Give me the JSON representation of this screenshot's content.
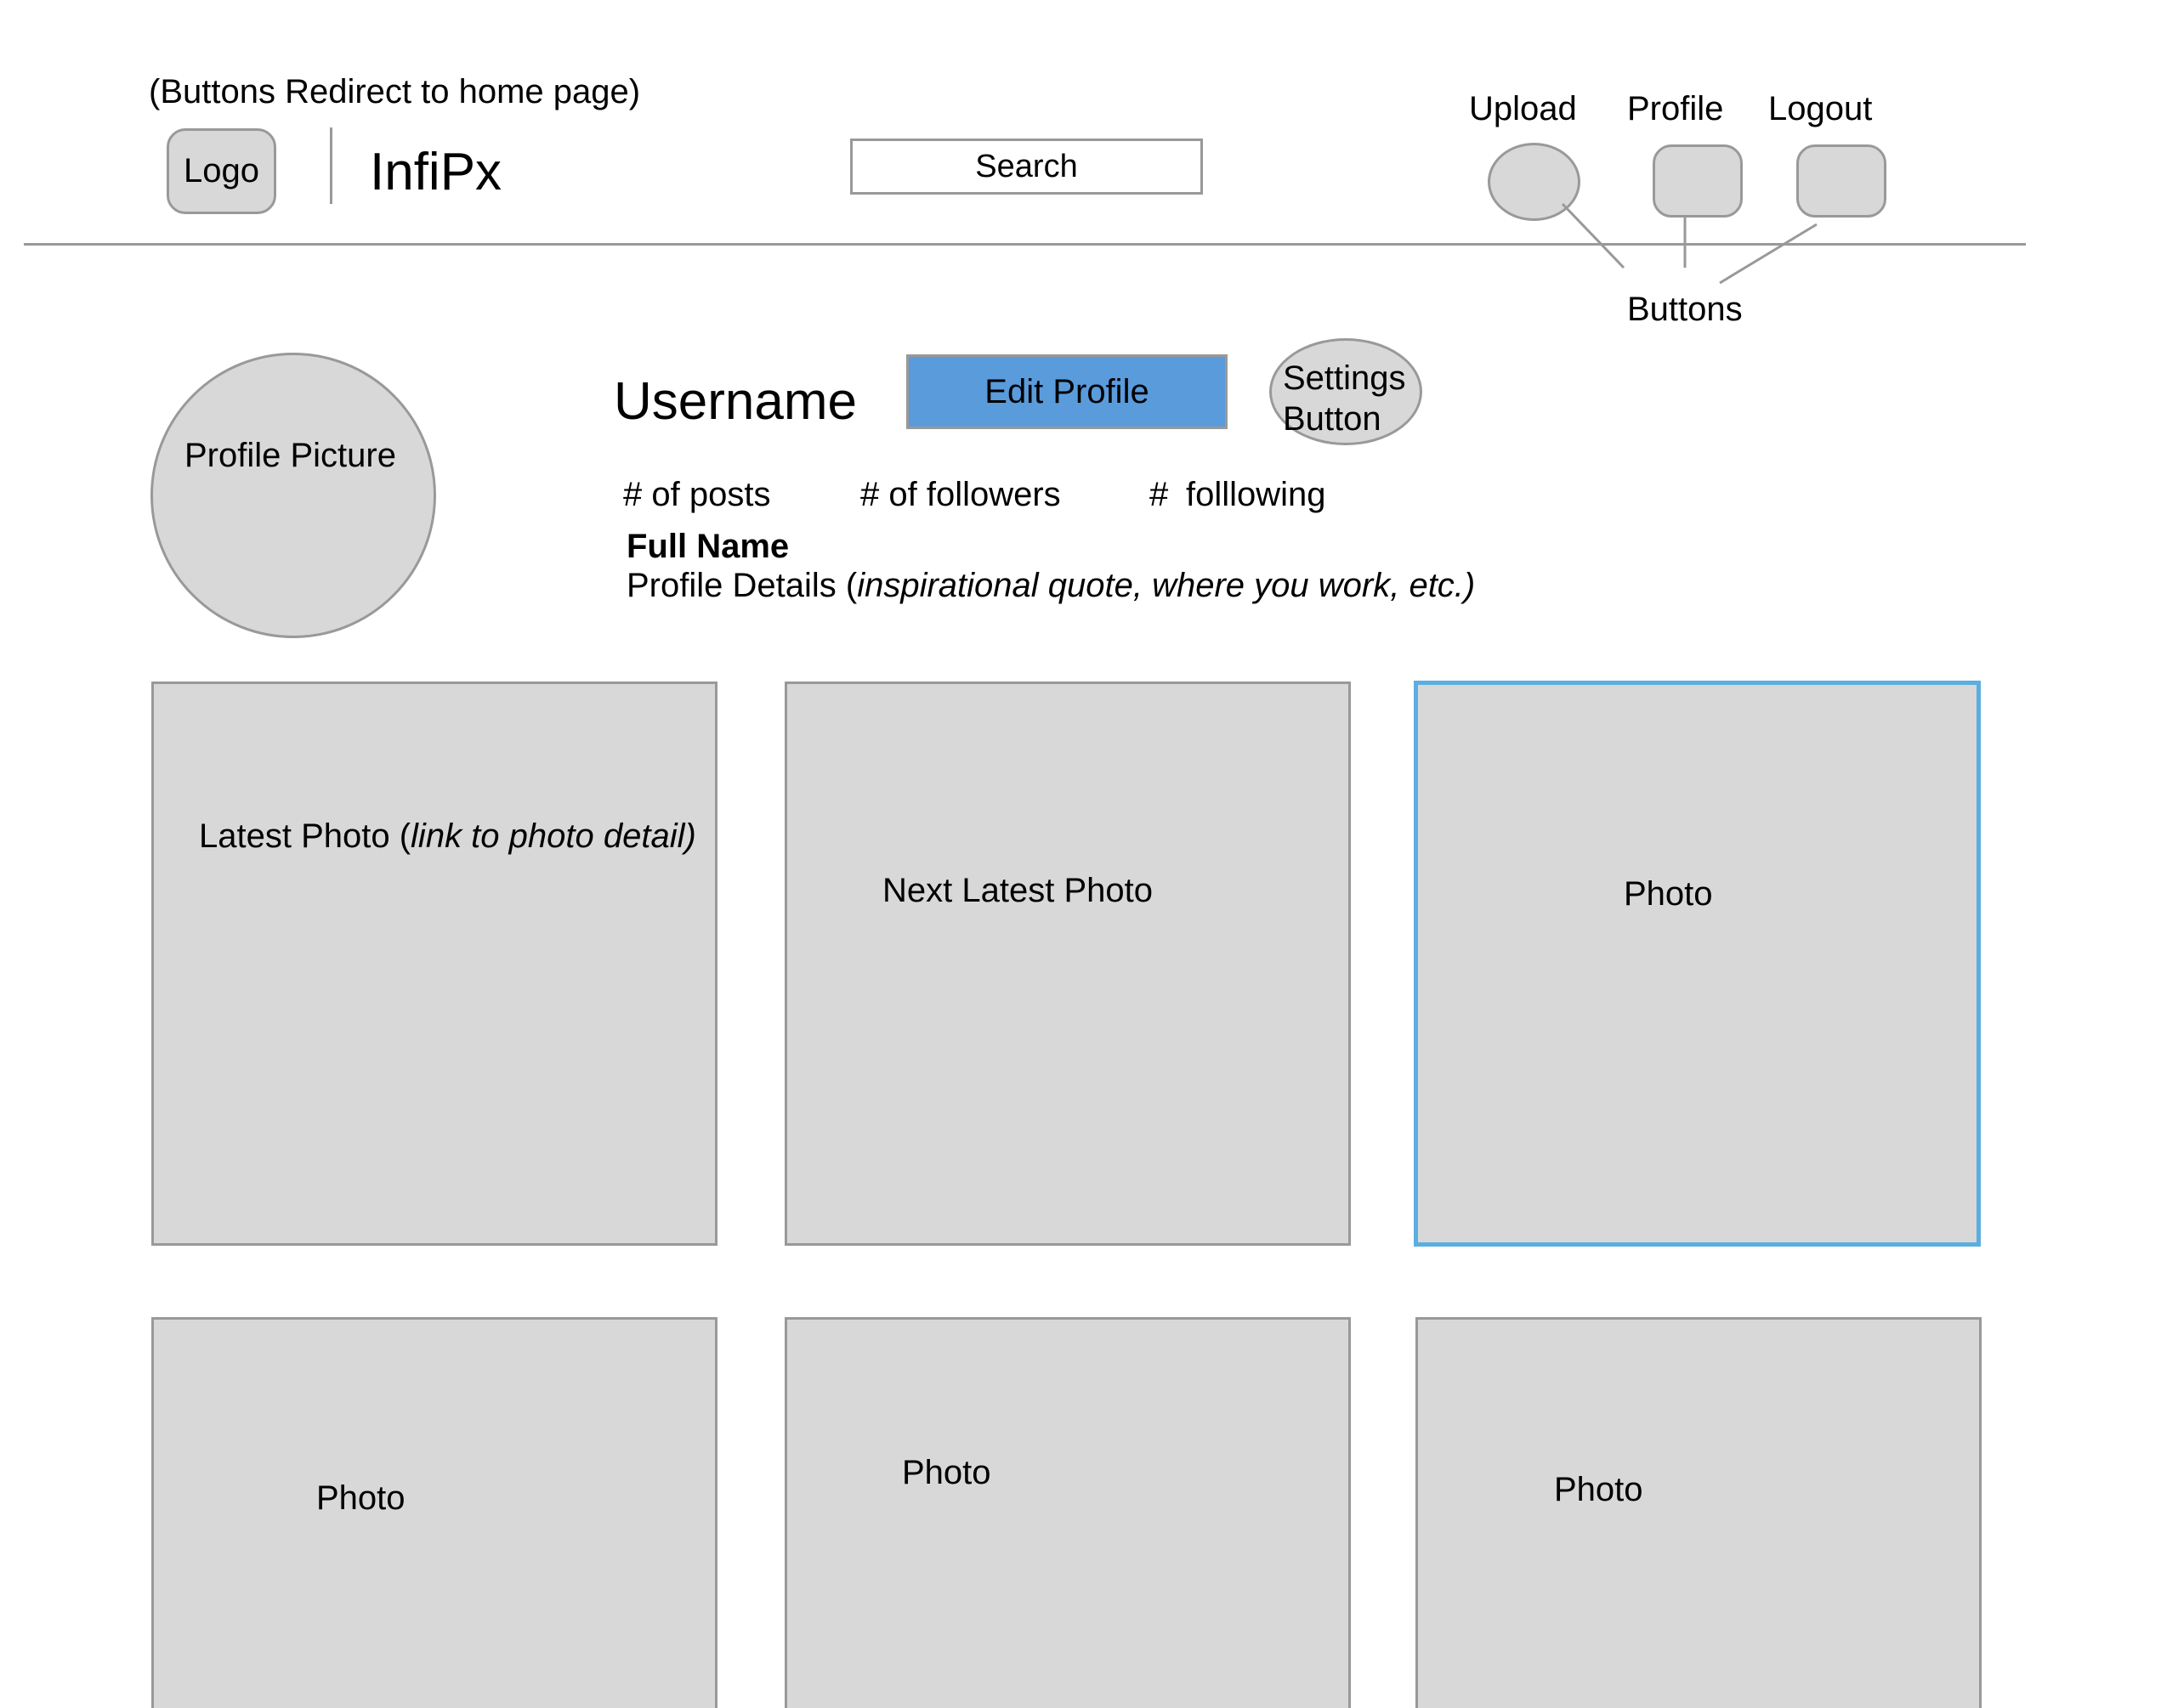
{
  "header": {
    "note": "(Buttons Redirect to home page)",
    "logo_label": "Logo",
    "app_name": "InfiPx",
    "search_label": "Search",
    "nav": {
      "upload_label": "Upload",
      "profile_label": "Profile",
      "logout_label": "Logout"
    },
    "buttons_callout": "Buttons"
  },
  "profile": {
    "picture_label": "Profile Picture",
    "username": "Username",
    "edit_profile_label": "Edit Profile",
    "settings_line1": "Settings",
    "settings_line2": "Button",
    "stats": {
      "posts": "# of posts",
      "followers": "# of followers",
      "following_hash": "#",
      "following": "folllowing"
    },
    "full_name": "Full Name",
    "details_prefix": "Profile Details (",
    "details_italic": "inspirational quote, where you work, etc.)"
  },
  "photos": {
    "latest_prefix": "Latest Photo (",
    "latest_italic": "link to photo detail)",
    "next_latest": "Next Latest Photo",
    "p3": "Photo",
    "p4": "Photo",
    "p5": "Photo",
    "p6": "Photo"
  },
  "colors": {
    "edit_profile_fill": "#5a9bdc",
    "selected_border": "#5aaee0",
    "placeholder_fill": "#d8d8d8",
    "placeholder_stroke": "#999999"
  }
}
